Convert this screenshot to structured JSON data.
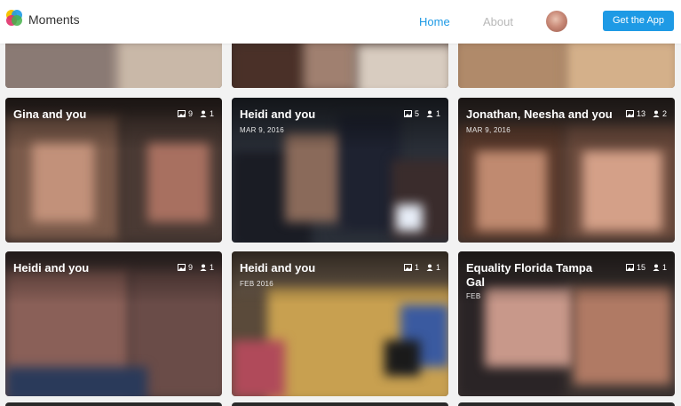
{
  "header": {
    "brand": "Moments",
    "nav": {
      "home": "Home",
      "about": "About"
    },
    "cta": "Get the App",
    "accent_color": "#1e9ae5"
  },
  "cards": [
    {
      "title": "Gina and you",
      "date": "",
      "photos": "9",
      "people": "1"
    },
    {
      "title": "Heidi and you",
      "date": "MAR 9, 2016",
      "photos": "5",
      "people": "1"
    },
    {
      "title": "Jonathan, Neesha and you",
      "date": "MAR 9, 2016",
      "photos": "13",
      "people": "2"
    },
    {
      "title": "Heidi and you",
      "date": "",
      "photos": "9",
      "people": "1"
    },
    {
      "title": "Heidi and you",
      "date": "FEB 2016",
      "photos": "1",
      "people": "1"
    },
    {
      "title": "Equality Florida Tampa Gal",
      "date": "FEB",
      "photos": "15",
      "people": "1"
    }
  ],
  "icons": {
    "photo": "photo-icon",
    "people": "person-icon"
  }
}
